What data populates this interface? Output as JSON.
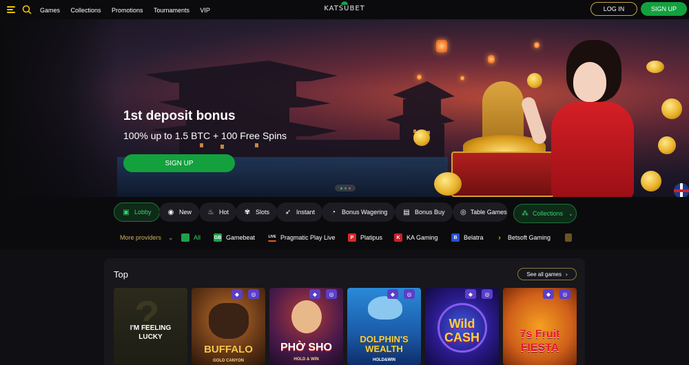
{
  "header": {
    "nav": [
      "Games",
      "Collections",
      "Promotions",
      "Tournaments",
      "VIP"
    ],
    "logo_text": "KATSUBET",
    "login_label": "LOG IN",
    "signup_label": "SIGN UP"
  },
  "hero": {
    "title": "1st deposit bonus",
    "subtitle": "100% up to 1.5 BTC + 100 Free Spins",
    "cta_label": "SIGN UP",
    "slides_total": 3,
    "active_slide": 1
  },
  "categories": {
    "items": [
      {
        "label": "Lobby",
        "icon": "lobby-icon",
        "active": true
      },
      {
        "label": "New",
        "icon": "eye-icon"
      },
      {
        "label": "Hot",
        "icon": "flame-icon"
      },
      {
        "label": "Slots",
        "icon": "slots-icon"
      },
      {
        "label": "Instant",
        "icon": "rocket-icon"
      },
      {
        "label": "Bonus Wagering",
        "icon": "bonus-icon"
      },
      {
        "label": "Bonus Buy",
        "icon": "gift-icon"
      },
      {
        "label": "Table Games",
        "icon": "chip-icon"
      }
    ],
    "collections_label": "Collections"
  },
  "providers": {
    "more_label": "More providers",
    "items": [
      {
        "label": "All",
        "icon_text": "",
        "color": "#1fa14a"
      },
      {
        "label": "Gamebeat",
        "icon_text": "GB",
        "color": "#1fa14a"
      },
      {
        "label": "Pragmatic Play Live",
        "icon_text": "LIVE",
        "color": "#0b0b0d"
      },
      {
        "label": "Platipus",
        "icon_text": "P",
        "color": "#d42a2a"
      },
      {
        "label": "KA Gaming",
        "icon_text": "K",
        "color": "#c8202a"
      },
      {
        "label": "Belatra",
        "icon_text": "B",
        "color": "#2a4fd0"
      },
      {
        "label": "Betsoft Gaming",
        "icon_text": "›",
        "color": "#0b0b0d"
      }
    ]
  },
  "top": {
    "title": "Top",
    "see_all_label": "See all games",
    "games": [
      {
        "title": "I'M FEELING LUCKY",
        "badges": 0
      },
      {
        "title": "BUFFALO",
        "subtitle": "GOLD CANYON",
        "badges": 2
      },
      {
        "title": "PHỜ SHO",
        "subtitle": "HOLD & WIN",
        "badges": 2
      },
      {
        "title": "DOLPHIN'S WEALTH",
        "subtitle": "HOLD&WIN",
        "badges": 2
      },
      {
        "title": "Wild CASH",
        "badges": 2
      },
      {
        "title": "7s Fruit FIESTA",
        "badges": 2
      }
    ]
  },
  "colors": {
    "accent_green": "#13a13e",
    "gold_border": "#c9a64a",
    "badge_purple": "#5a3fc8"
  }
}
